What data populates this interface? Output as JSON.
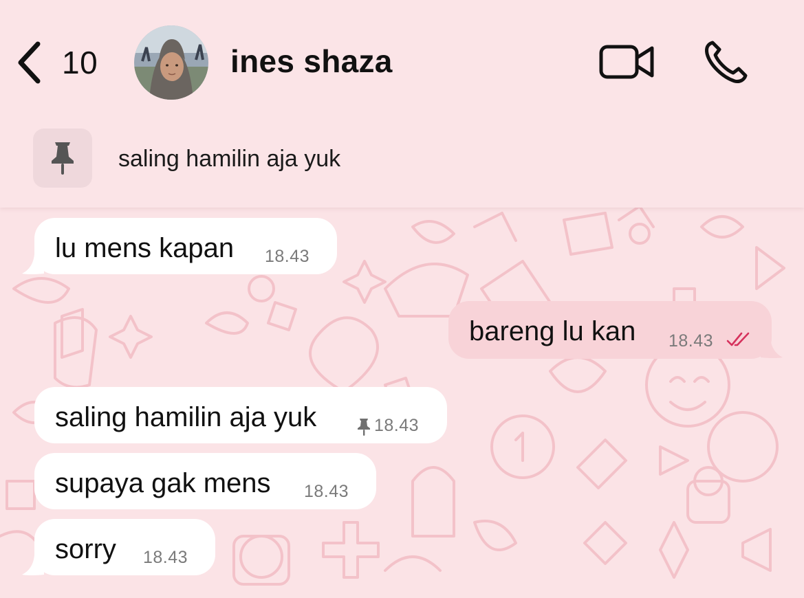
{
  "header": {
    "back_count": "10",
    "contact_name": "ines shaza"
  },
  "pinned": {
    "text": "saling hamilin aja yuk"
  },
  "messages": [
    {
      "direction": "incoming",
      "text": "lu mens kapan",
      "time": "18.43"
    },
    {
      "direction": "outgoing",
      "text": "bareng lu kan",
      "time": "18.43",
      "status": "read"
    },
    {
      "direction": "incoming",
      "text": "saling hamilin aja yuk",
      "time": "18.43",
      "pinned": true
    },
    {
      "direction": "incoming",
      "text": "supaya gak mens",
      "time": "18.43"
    },
    {
      "direction": "incoming",
      "text": "sorry",
      "time": "18.43"
    }
  ],
  "colors": {
    "background": "#fbe3e6",
    "outgoing_bubble": "#f8d3d8",
    "incoming_bubble": "#ffffff",
    "read_tick": "#d6315c"
  },
  "icons": {
    "back": "chevron-left-icon",
    "video": "video-camera-icon",
    "call": "phone-icon",
    "pin": "pin-icon",
    "read": "double-check-icon"
  }
}
